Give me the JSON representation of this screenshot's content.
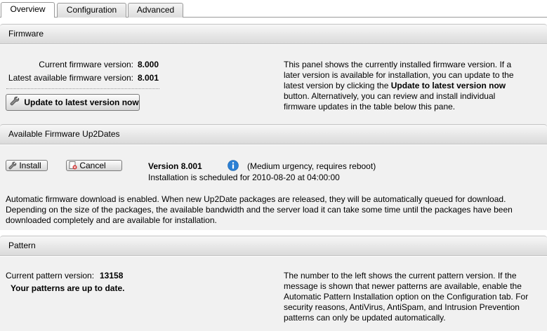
{
  "tabs": [
    {
      "label": "Overview",
      "active": true
    },
    {
      "label": "Configuration",
      "active": false
    },
    {
      "label": "Advanced",
      "active": false
    }
  ],
  "firmware": {
    "header": "Firmware",
    "current_label": "Current firmware version:",
    "current_value": "8.000",
    "latest_label": "Latest available firmware version:",
    "latest_value": "8.001",
    "update_button": "Update to latest version now",
    "desc_1": "This panel shows the currently installed firmware version. If a later version is available for installation, you can update to the latest version by clicking the ",
    "desc_bold": "Update to latest version now",
    "desc_2": " button. Alternatively, you can review and install individual firmware updates in the table below this pane."
  },
  "up2dates": {
    "header": "Available Firmware Up2Dates",
    "install_button": "Install",
    "cancel_button": "Cancel",
    "version_label": "Version 8.001",
    "urgency": "(Medium urgency, requires reboot)",
    "scheduled": "Installation is scheduled for 2010-08-20 at 04:00:00",
    "auto_note": "Automatic firmware download is enabled. When new Up2Date packages are released, they will be automatically queued for download. Depending on the size of the packages, the available bandwidth and the server load it can take some time until the packages have been downloaded completely and are available for installation."
  },
  "pattern": {
    "header": "Pattern",
    "current_label": "Current pattern version:",
    "current_value": "13158",
    "status": "Your patterns are up to date.",
    "desc": "The number to the left shows the current pattern version. If the message is shown that newer patterns are available, enable the Automatic Pattern Installation option on the Configuration tab. For security reasons, AntiVirus, AntiSpam, and Intrusion Prevention patterns can only be updated automatically."
  },
  "colors": {
    "info_icon": "#2a7fd4",
    "cancel_icon": "#d03030"
  },
  "icons": {
    "update": "wrench-icon",
    "install": "wrench-icon",
    "cancel": "cancel-icon",
    "info": "info-icon"
  }
}
